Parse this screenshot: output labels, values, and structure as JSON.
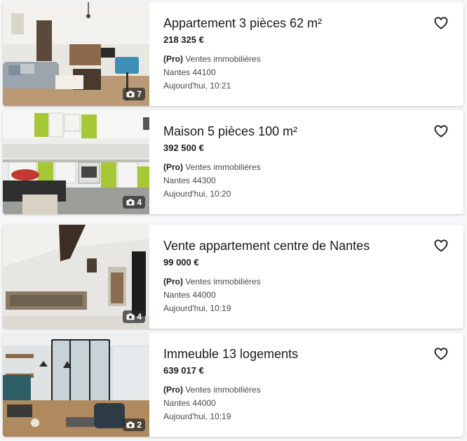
{
  "listings": [
    {
      "title": "Appartement 3 pièces 62 m²",
      "price": "218 325 €",
      "pro_label": "(Pro)",
      "seller": "Ventes immobilières",
      "location": "Nantes 44100",
      "date": "Aujourd'hui, 10:21",
      "photo_count": "7"
    },
    {
      "title": "Maison 5 pièces 100 m²",
      "price": "392 500 €",
      "pro_label": "(Pro)",
      "seller": "Ventes immobilières",
      "location": "Nantes 44300",
      "date": "Aujourd'hui, 10:20",
      "photo_count": "4"
    },
    {
      "title": "Vente appartement centre de Nantes",
      "price": "99 000 €",
      "pro_label": "(Pro)",
      "seller": "Ventes immobilières",
      "location": "Nantes 44000",
      "date": "Aujourd'hui, 10:19",
      "photo_count": "4"
    },
    {
      "title": "Immeuble 13 logements",
      "price": "639 017 €",
      "pro_label": "(Pro)",
      "seller": "Ventes immobilières",
      "location": "Nantes 44000",
      "date": "Aujourd'hui, 10:19",
      "photo_count": "2"
    }
  ],
  "icons": {
    "favorite": "heart-outline-icon",
    "photos": "camera-icon"
  },
  "colors": {
    "card_bg": "#ffffff",
    "page_bg": "#f4f6f7",
    "badge_bg": "#282828"
  }
}
